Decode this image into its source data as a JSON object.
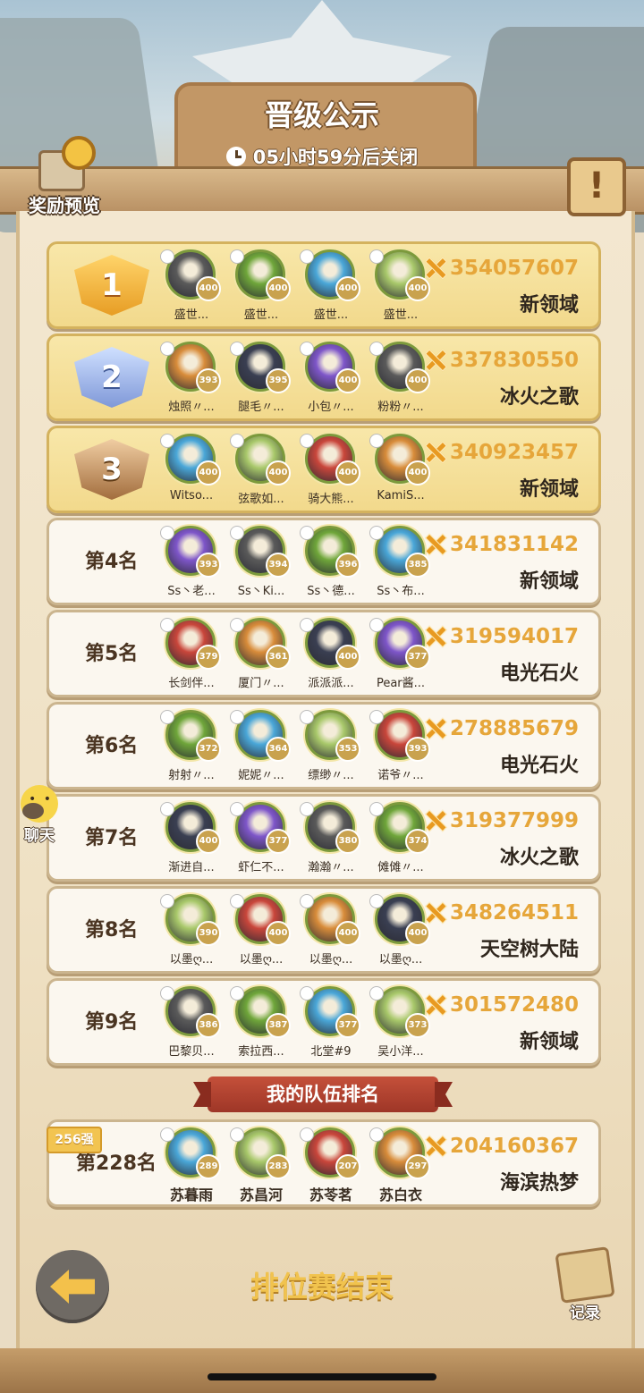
{
  "header": {
    "title": "晋级公示",
    "countdown": "05小时59分后关闭",
    "reward_label": "奖励预览",
    "info_glyph": "!"
  },
  "icons": {
    "clock": "clock-icon",
    "score": "crossed-swords-icon",
    "reward": "key-chest-icon",
    "info": "exclamation-icon",
    "chat": "smiley-chat-icon",
    "back": "arrow-left-icon",
    "record": "scroll-quill-icon"
  },
  "colors": {
    "gold_card": "#f4dc92",
    "white_card": "#fbf7ef",
    "score_text": "#e6a63a",
    "ribbon_red": "#b5432f"
  },
  "ranks": [
    {
      "rank_label": "1",
      "badge": "gold",
      "score": "354057607",
      "team": "新领域",
      "members": [
        {
          "name": "盛世...",
          "level": "400"
        },
        {
          "name": "盛世...",
          "level": "400"
        },
        {
          "name": "盛世...",
          "level": "400"
        },
        {
          "name": "盛世...",
          "level": "400"
        }
      ]
    },
    {
      "rank_label": "2",
      "badge": "silver",
      "score": "337830550",
      "team": "冰火之歌",
      "members": [
        {
          "name": "烛照〃...",
          "level": "393"
        },
        {
          "name": "腿毛〃...",
          "level": "395"
        },
        {
          "name": "小包〃...",
          "level": "400"
        },
        {
          "name": "粉粉〃...",
          "level": "400"
        }
      ]
    },
    {
      "rank_label": "3",
      "badge": "bronze",
      "score": "340923457",
      "team": "新领域",
      "members": [
        {
          "name": "Witso...",
          "level": "400"
        },
        {
          "name": "弦歌如...",
          "level": "400"
        },
        {
          "name": "骑大熊...",
          "level": "400"
        },
        {
          "name": "KamiS...",
          "level": "400"
        }
      ]
    },
    {
      "rank_label": "第4名",
      "badge": "",
      "score": "341831142",
      "team": "新领域",
      "members": [
        {
          "name": "Ss丶老...",
          "level": "393"
        },
        {
          "name": "Ss丶Ki...",
          "level": "394"
        },
        {
          "name": "Ss丶德...",
          "level": "396"
        },
        {
          "name": "Ss丶布...",
          "level": "385"
        }
      ]
    },
    {
      "rank_label": "第5名",
      "badge": "",
      "score": "319594017",
      "team": "电光石火",
      "members": [
        {
          "name": "长剑伴...",
          "level": "379"
        },
        {
          "name": "厦门〃...",
          "level": "361"
        },
        {
          "name": "派派派...",
          "level": "400"
        },
        {
          "name": "Pear酱...",
          "level": "377"
        }
      ]
    },
    {
      "rank_label": "第6名",
      "badge": "",
      "score": "278885679",
      "team": "电光石火",
      "members": [
        {
          "name": "射射〃...",
          "level": "372"
        },
        {
          "name": "妮妮〃...",
          "level": "364"
        },
        {
          "name": "缥缈〃...",
          "level": "353"
        },
        {
          "name": "诺爷〃...",
          "level": "393"
        }
      ]
    },
    {
      "rank_label": "第7名",
      "badge": "",
      "score": "319377999",
      "team": "冰火之歌",
      "members": [
        {
          "name": "渐进自...",
          "level": "400"
        },
        {
          "name": "虾仁不...",
          "level": "377"
        },
        {
          "name": "瀚瀚〃...",
          "level": "380"
        },
        {
          "name": "傩傩〃...",
          "level": "374"
        }
      ]
    },
    {
      "rank_label": "第8名",
      "badge": "",
      "score": "348264511",
      "team": "天空树大陆",
      "members": [
        {
          "name": "以墨ღ...",
          "level": "390"
        },
        {
          "name": "以墨ღ...",
          "level": "400"
        },
        {
          "name": "以墨ღ...",
          "level": "400"
        },
        {
          "name": "以墨ღ...",
          "level": "400"
        }
      ]
    },
    {
      "rank_label": "第9名",
      "badge": "",
      "score": "301572480",
      "team": "新领域",
      "members": [
        {
          "name": "巴黎贝...",
          "level": "386"
        },
        {
          "name": "索拉西...",
          "level": "387"
        },
        {
          "name": "北堂#9",
          "level": "377"
        },
        {
          "name": "吴小洋...",
          "level": "373"
        }
      ]
    }
  ],
  "my_team": {
    "section_title": "我的队伍排名",
    "tag": "256强",
    "rank_label": "第228名",
    "score": "204160367",
    "team": "海滨热梦",
    "members": [
      {
        "name": "苏暮雨",
        "level": "289"
      },
      {
        "name": "苏昌河",
        "level": "283"
      },
      {
        "name": "苏苓茗",
        "level": "207"
      },
      {
        "name": "苏白衣",
        "level": "297"
      }
    ]
  },
  "chat_label": "聊天",
  "footer": {
    "status": "排位赛结束",
    "record_label": "记录"
  }
}
